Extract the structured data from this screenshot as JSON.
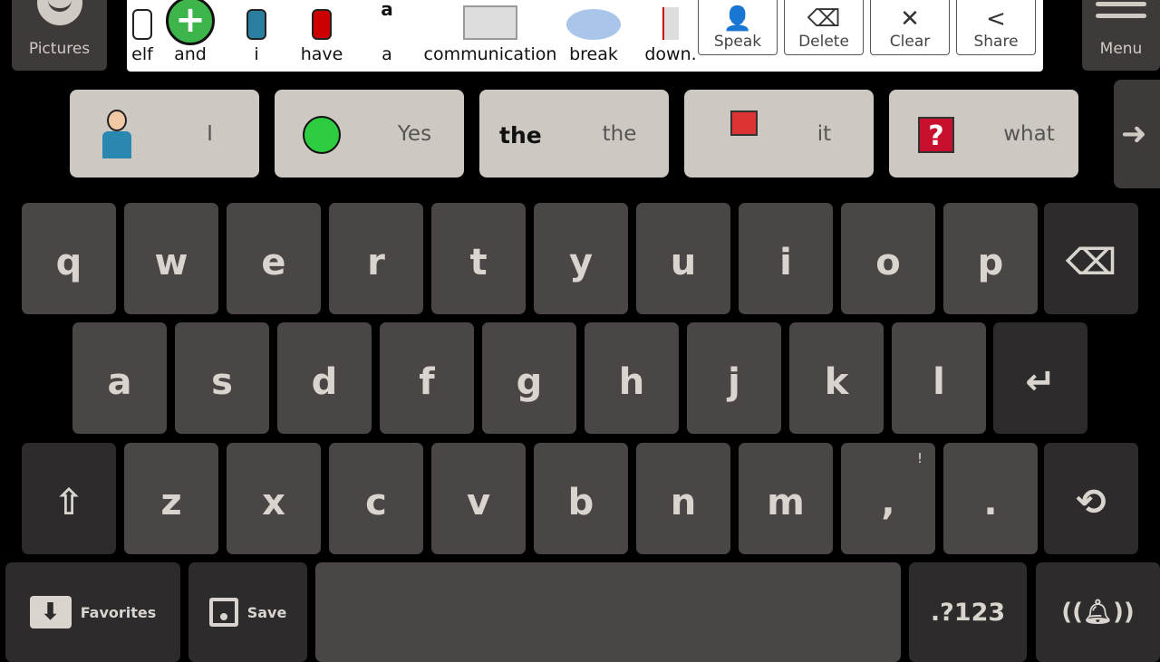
{
  "left_panel": {
    "label": "Pictures",
    "icon": "smiley-icon"
  },
  "right_panel": {
    "label": "Menu",
    "icon": "hamburger-icon"
  },
  "message": {
    "words": [
      "elf",
      "and",
      "i",
      "have",
      "a",
      "communication",
      "break",
      "down."
    ]
  },
  "message_buttons": [
    {
      "label": "Speak",
      "icon": "speaker-person-icon"
    },
    {
      "label": "Delete",
      "icon": "backspace-icon"
    },
    {
      "label": "Clear",
      "icon": "clear-icon"
    },
    {
      "label": "Share",
      "icon": "share-icon"
    }
  ],
  "suggestions": [
    {
      "label": "I",
      "icon": "person-self-icon"
    },
    {
      "label": "Yes",
      "icon": "green-smiley-icon"
    },
    {
      "label": "the",
      "picture_text": "the",
      "icon": "text-the-icon"
    },
    {
      "label": "it",
      "icon": "pointing-hand-icon"
    },
    {
      "label": "what",
      "icon": "question-mark-icon"
    }
  ],
  "suggestion_next": {
    "icon": "arrow-right-icon"
  },
  "keyboard": {
    "row1": [
      "q",
      "w",
      "e",
      "r",
      "t",
      "y",
      "u",
      "i",
      "o",
      "p"
    ],
    "row2": [
      "a",
      "s",
      "d",
      "f",
      "g",
      "h",
      "j",
      "k",
      "l"
    ],
    "row3": [
      "z",
      "x",
      "c",
      "v",
      "b",
      "n",
      "m",
      ",",
      "."
    ],
    "row3_alts": {
      ",": "!",
      ".": "?"
    },
    "favorites": "Favorites",
    "save": "Save",
    "symbols": ".?123"
  },
  "colors": {
    "key": "#4a4645",
    "special_key": "#2d2b2b",
    "suggestion": "#cdc8c2"
  }
}
